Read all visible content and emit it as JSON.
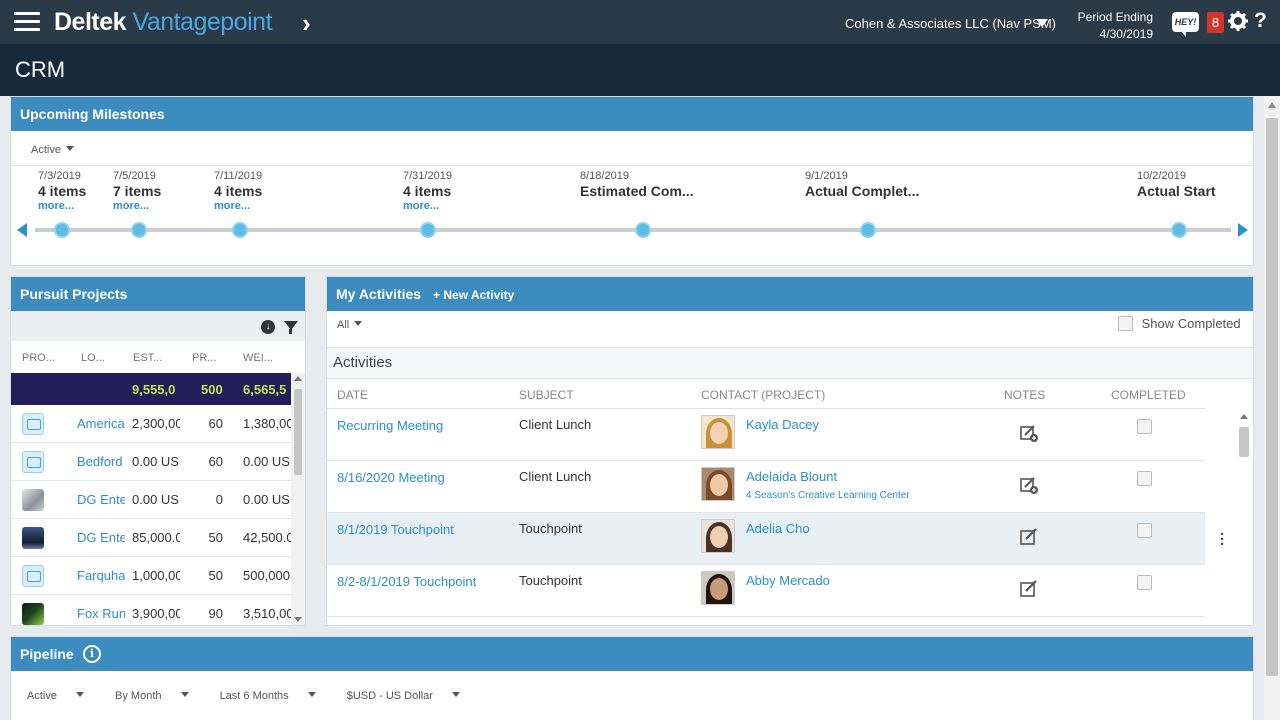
{
  "header": {
    "brand_main": "Deltek",
    "brand_product": "Vantagepoint",
    "company": "Cohen & Associates LLC (Nav PSM)",
    "period_label": "Period Ending",
    "period_date": "4/30/2019",
    "hey_label": "HEY!",
    "notification_count": "8"
  },
  "page": {
    "title": "CRM"
  },
  "milestones": {
    "title": "Upcoming Milestones",
    "filter": "Active",
    "items": [
      {
        "date": "7/3/2019",
        "label": "4 items",
        "more": "more..."
      },
      {
        "date": "7/5/2019",
        "label": "7 items",
        "more": "more..."
      },
      {
        "date": "7/11/2019",
        "label": "4 items",
        "more": "more..."
      },
      {
        "date": "7/31/2019",
        "label": "4 items",
        "more": "more..."
      },
      {
        "date": "8/18/2019",
        "label": "Estimated Com..."
      },
      {
        "date": "9/1/2019",
        "label": "Actual Complet..."
      },
      {
        "date": "10/2/2019",
        "label": "Actual Start"
      }
    ]
  },
  "pursuit": {
    "title": "Pursuit Projects",
    "columns": [
      "PRO...",
      "LO...",
      "EST...",
      "PR...",
      "WEI..."
    ],
    "totals": {
      "est": "9,555,0",
      "pr": "500",
      "wt": "6,565,5"
    },
    "rows": [
      {
        "icon": "plan",
        "name": "America",
        "est": "2,300,00",
        "pr": "60",
        "wt": "1,380,00"
      },
      {
        "icon": "plan",
        "name": "Bedford",
        "est": "0.00 USI",
        "pr": "60",
        "wt": "0.00 USI"
      },
      {
        "icon": "photo1",
        "name": "DG Ente",
        "est": "0.00 USI",
        "pr": "0",
        "wt": "0.00 USI"
      },
      {
        "icon": "photo2",
        "name": "DG Ente",
        "est": "85,000.0",
        "pr": "50",
        "wt": "42,500.0"
      },
      {
        "icon": "plan",
        "name": "Farquha",
        "est": "1,000,00",
        "pr": "50",
        "wt": "500,000"
      },
      {
        "icon": "photo3",
        "name": "Fox Run",
        "est": "3,900,00",
        "pr": "90",
        "wt": "3,510,00"
      }
    ]
  },
  "activities": {
    "title": "My Activities",
    "new_activity": "New Activity",
    "filter": "All",
    "show_completed": "Show Completed",
    "subheader": "Activities",
    "columns": {
      "date": "DATE",
      "subject": "SUBJECT",
      "contact": "CONTACT (PROJECT)",
      "notes": "NOTES",
      "completed": "COMPLETED"
    },
    "rows": [
      {
        "date": "Recurring Meeting",
        "subject": "Client Lunch",
        "contact": "Kayla Dacey",
        "project": "",
        "note_type": "add"
      },
      {
        "date": "8/16/2020 Meeting",
        "subject": "Client Lunch",
        "contact": "Adelaida Blount",
        "project": "4 Season's Creative Learning Center",
        "note_type": "add"
      },
      {
        "date": "8/1/2019 Touchpoint",
        "subject": "Touchpoint",
        "contact": "Adelia Cho",
        "project": "",
        "note_type": "edit"
      },
      {
        "date": "8/2-8/1/2019 Touchpoint",
        "subject": "Touchpoint",
        "contact": "Abby Mercado",
        "project": "",
        "note_type": "edit"
      }
    ]
  },
  "pipeline": {
    "title": "Pipeline",
    "filters": [
      "Active",
      "By Month",
      "Last 6 Months",
      "$USD - US Dollar"
    ]
  },
  "colors": {
    "topbar": "#2b3a47",
    "titlebar": "#17293a",
    "panel_header": "#3d8cc0",
    "link": "#2b8fd0",
    "total_row": "#221e5a",
    "total_text": "#c3e25a",
    "notification": "#d0342c"
  }
}
